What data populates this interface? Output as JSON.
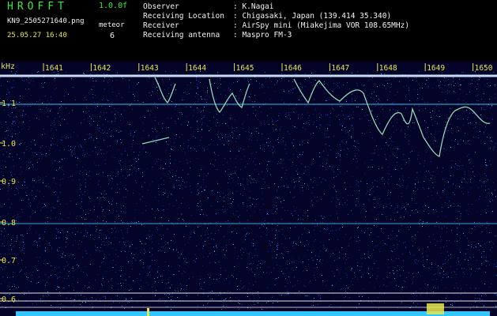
{
  "header": {
    "app_title": "HROFFT",
    "version": "1.0.0f",
    "file_name": "KN9_2505271640.png",
    "timestamp": "25.05.27 16:40",
    "mode_label": "meteor",
    "mode_value": "6",
    "info": [
      {
        "label": "Observer",
        "value": ": K.Nagai"
      },
      {
        "label": "Receiving Location",
        "value": ": Chigasaki, Japan (139.414 35.340)"
      },
      {
        "label": "Receiver",
        "value": ": AirSpy mini (Miakejima VOR 108.65MHz)"
      },
      {
        "label": "Receiving antenna",
        "value": ": Maspro FM-3"
      }
    ]
  },
  "axes": {
    "y_unit": "kHz",
    "y_ticks": [
      "1.1",
      "1.0",
      "0.9",
      "0.8",
      "0.7",
      "0.6"
    ],
    "x_ticks": [
      "1641",
      "1642",
      "1643",
      "1644",
      "1645",
      "1646",
      "1647",
      "1648",
      "1649",
      "1650"
    ]
  },
  "colors": {
    "noise_dark": "#06063a",
    "noise_mid": "#1b3fd0",
    "noise_bright": "#35b8ff",
    "trace": "#9ff0c0",
    "carrier": "#cfe9ff",
    "tick_text": "#e6e64d",
    "header_green": "#3fe83f"
  }
}
